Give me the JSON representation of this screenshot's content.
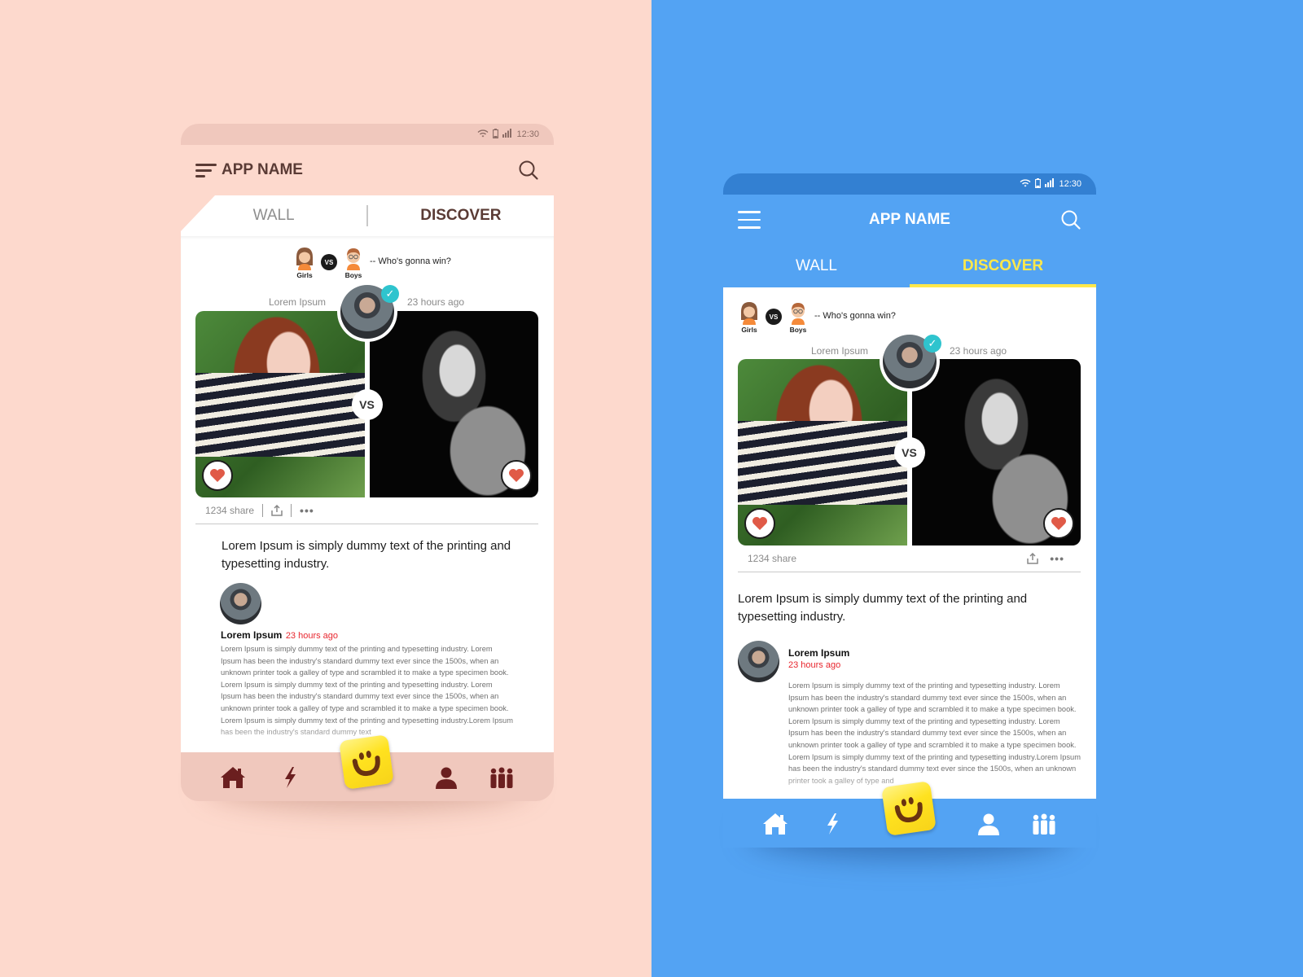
{
  "colors": {
    "left_bg": "#fdd9cd",
    "left_status": "#f0c8bd",
    "left_dark": "#5a3b35",
    "right_bg": "#53a3f3",
    "right_status": "#3380d2",
    "accent_yellow": "#ffe84b",
    "time_red": "#e8262e",
    "verified_teal": "#2fc4ce",
    "heart_red": "#e05a47",
    "icon_maroon": "#6b1f1f"
  },
  "screens": [
    {
      "theme": "peach",
      "statusbar": {
        "time": "12:30",
        "icons": [
          "wifi-icon",
          "battery-icon",
          "signal-icon"
        ]
      },
      "appbar": {
        "title": "APP NAME",
        "menu_icon": "menu-icon",
        "search_icon": "search-icon"
      },
      "tabs": [
        {
          "label": "WALL",
          "active": false
        },
        {
          "label": "DISCOVER",
          "active": true
        }
      ],
      "vs_header": {
        "left_label": "Girls",
        "vs_label": "VS",
        "right_label": "Boys",
        "question": "-- Who's gonna win?"
      },
      "post": {
        "author": "Lorem Ipsum",
        "time": "23 hours ago",
        "vs_label": "VS",
        "share_count": "1234 share",
        "more_label": "•••",
        "title": "Lorem Ipsum is simply dummy text of the printing and typesetting industry."
      },
      "comment": {
        "name": "Lorem Ipsum",
        "time": "23 hours ago",
        "body": "Lorem Ipsum is simply dummy text of the printing and typesetting industry. Lorem Ipsum has been the industry's standard dummy text ever since the 1500s, when an unknown printer took a galley of type and scrambled it to make a type specimen book. Lorem Ipsum is simply dummy text of the printing and typesetting industry. Lorem Ipsum has been the industry's standard dummy text ever since the 1500s, when an unknown printer took a galley of type and scrambled it to make a type specimen book. Lorem Ipsum is simply dummy text of the printing and typesetting industry.Lorem Ipsum has been the industry's standard dummy text"
      },
      "bottom_nav": [
        "home-icon",
        "flash-icon",
        "smiley-icon",
        "profile-icon",
        "group-icon"
      ]
    },
    {
      "theme": "blue",
      "statusbar": {
        "time": "12:30",
        "icons": [
          "wifi-icon",
          "battery-icon",
          "signal-icon"
        ]
      },
      "appbar": {
        "title": "APP NAME",
        "menu_icon": "menu-icon",
        "search_icon": "search-icon"
      },
      "tabs": [
        {
          "label": "WALL",
          "active": false
        },
        {
          "label": "DISCOVER",
          "active": true
        }
      ],
      "vs_header": {
        "left_label": "Girls",
        "vs_label": "VS",
        "right_label": "Boys",
        "question": "-- Who's gonna win?"
      },
      "post": {
        "author": "Lorem Ipsum",
        "time": "23 hours ago",
        "vs_label": "VS",
        "share_count": "1234 share",
        "more_label": "•••",
        "title": "Lorem Ipsum is simply dummy text of the printing and typesetting industry."
      },
      "comment": {
        "name": "Lorem Ipsum",
        "time": "23 hours ago",
        "body": "Lorem Ipsum is simply dummy text of the printing and typesetting industry. Lorem Ipsum has been the industry's standard dummy text ever since the 1500s, when an unknown printer took a galley of type and scrambled it to make a type specimen book. Lorem Ipsum is simply dummy text of the printing and typesetting industry. Lorem Ipsum has been the industry's standard dummy text ever since the 1500s, when an unknown printer took a galley of type and scrambled it to make a type specimen book. Lorem Ipsum is simply dummy text of the printing and typesetting industry.Lorem Ipsum has been the industry's standard dummy text ever since the 1500s, when an unknown printer took a galley of type and"
      },
      "bottom_nav": [
        "home-icon",
        "flash-icon",
        "smiley-icon",
        "profile-icon",
        "group-icon"
      ]
    }
  ]
}
